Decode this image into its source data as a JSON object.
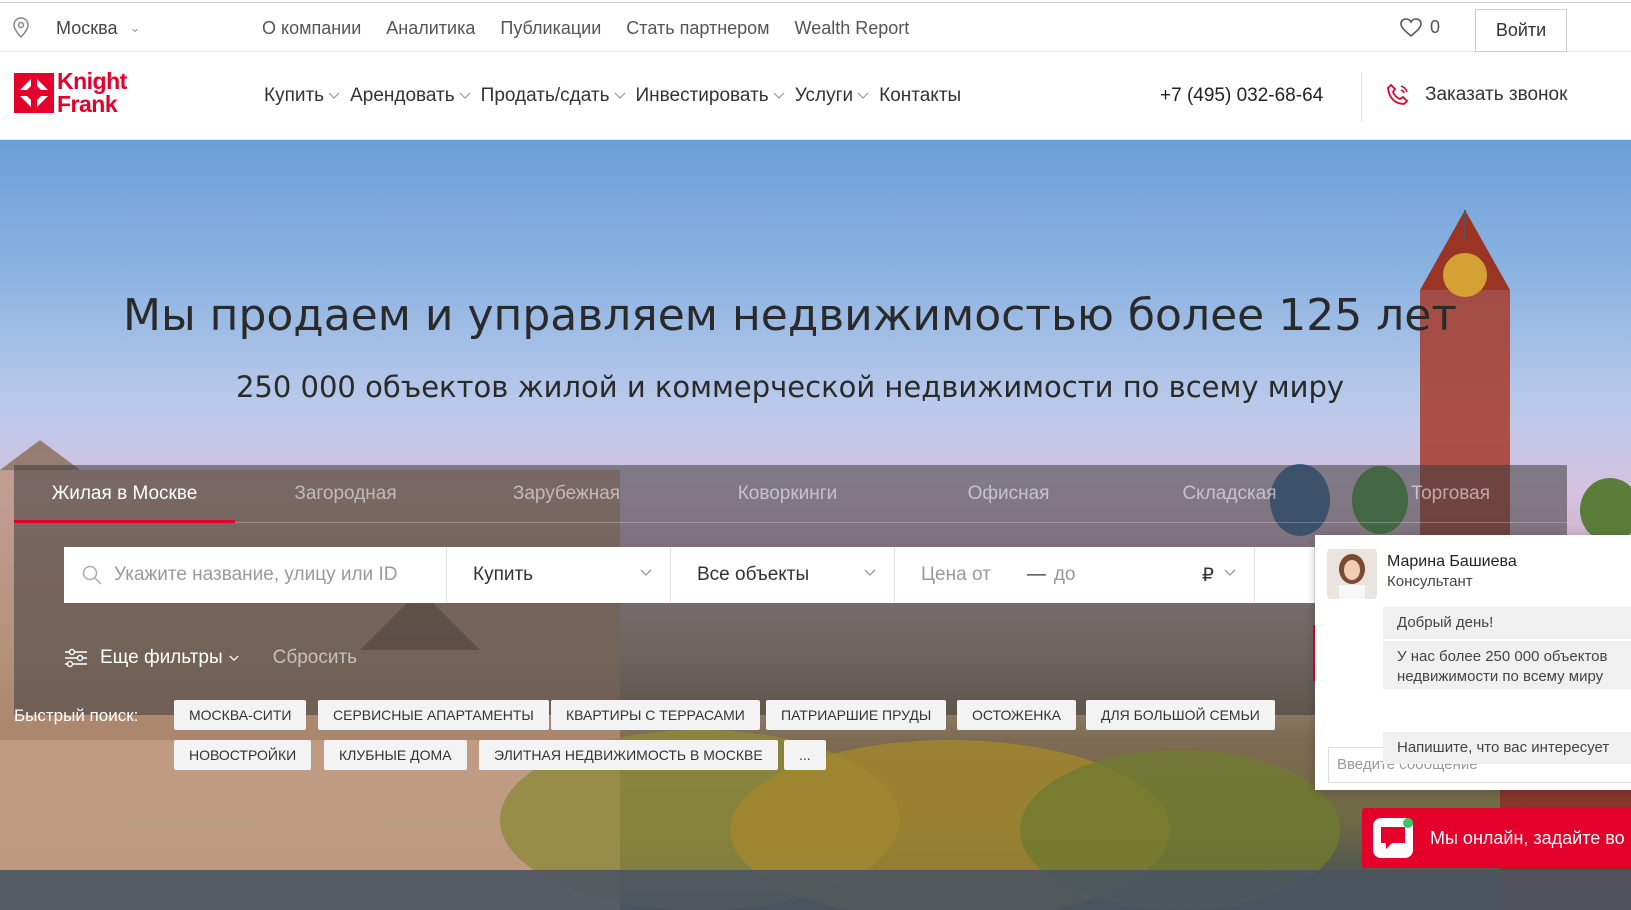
{
  "topbar": {
    "city": "Москва",
    "links": [
      "О компании",
      "Аналитика",
      "Публикации",
      "Стать партнером",
      "Wealth Report"
    ],
    "favorites_count": "0",
    "login_label": "Войти"
  },
  "logo": {
    "line1": "Knight",
    "line2": "Frank"
  },
  "nav": {
    "items": [
      "Купить",
      "Арендовать",
      "Продать/сдать",
      "Инвестировать",
      "Услуги",
      "Контакты"
    ],
    "phone": "+7 (495) 032-68-64",
    "callback_label": "Заказать звонок"
  },
  "hero": {
    "title": "Мы продаем и управляем недвижимостью более 125 лет",
    "subtitle": "250 000 объектов жилой и коммерческой недвижимости по всему миру"
  },
  "search": {
    "tabs": [
      "Жилая в Москве",
      "Загородная",
      "Зарубежная",
      "Коворкинги",
      "Офисная",
      "Складская",
      "Торговая"
    ],
    "active_tab": 0,
    "placeholder": "Укажите название, улицу или ID",
    "deal_type": "Купить",
    "object_type": "Все объекты",
    "price_from": "Цена от",
    "price_dash": "—",
    "price_to": "до",
    "currency": "₽",
    "more_filters": "Еще фильтры",
    "reset": "Сбросить"
  },
  "quick": {
    "label": "Быстрый поиск:",
    "chips": [
      "Москва-Сити",
      "Сервисные апартаменты",
      "Квартиры с террасами",
      "Патриаршие пруды",
      "Остоженка",
      "Для большой семьи",
      "Новостройки",
      "Клубные дома",
      "Элитная недвижимость в Москве",
      "..."
    ]
  },
  "chat": {
    "agent_name": "Марина Башиева",
    "agent_role": "Консультант",
    "messages": [
      "Добрый день!",
      "У нас более 250 000 объектов",
      "недвижимости по всему миру",
      "Напишите, что вас интересует"
    ],
    "input_placeholder": "Введите сообщение",
    "online_text": "Мы онлайн, задайте во"
  },
  "colors": {
    "brand": "#e4002b"
  }
}
